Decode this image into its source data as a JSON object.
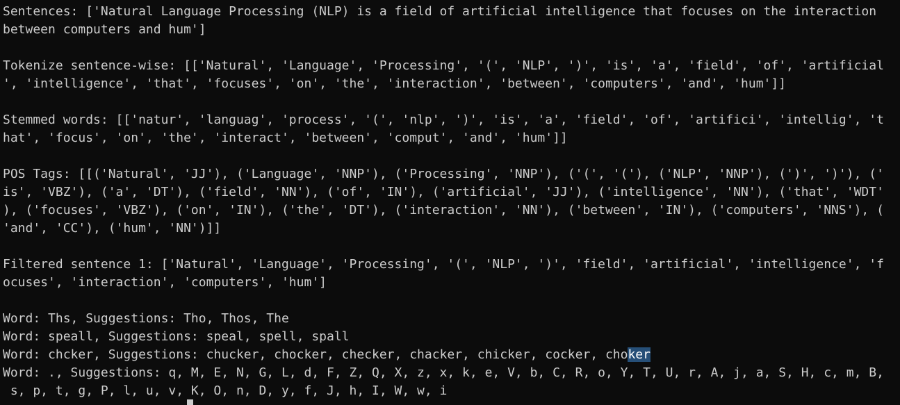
{
  "terminal": {
    "clipped_top": "-------------------------------",
    "lines": [
      "Sentences: ['Natural Language Processing (NLP) is a field of artificial intelligence that focuses on the interaction",
      "between computers and hum']",
      "",
      "Tokenize sentence-wise: [['Natural', 'Language', 'Processing', '(', 'NLP', ')', 'is', 'a', 'field', 'of', 'artificial",
      "', 'intelligence', 'that', 'focuses', 'on', 'the', 'interaction', 'between', 'computers', 'and', 'hum']]",
      "",
      "Stemmed words: [['natur', 'languag', 'process', '(', 'nlp', ')', 'is', 'a', 'field', 'of', 'artifici', 'intellig', 't",
      "hat', 'focus', 'on', 'the', 'interact', 'between', 'comput', 'and', 'hum']]",
      "",
      "POS Tags: [[('Natural', 'JJ'), ('Language', 'NNP'), ('Processing', 'NNP'), ('(', '('), ('NLP', 'NNP'), (')', ')'), ('",
      "is', 'VBZ'), ('a', 'DT'), ('field', 'NN'), ('of', 'IN'), ('artificial', 'JJ'), ('intelligence', 'NN'), ('that', 'WDT'",
      "), ('focuses', 'VBZ'), ('on', 'IN'), ('the', 'DT'), ('interaction', 'NN'), ('between', 'IN'), ('computers', 'NNS'), (",
      "'and', 'CC'), ('hum', 'NN')]]",
      "",
      "Filtered sentence 1: ['Natural', 'Language', 'Processing', '(', 'NLP', ')', 'field', 'artificial', 'intelligence', 'f",
      "ocuses', 'interaction', 'computers', 'hum']",
      "",
      "Word: Ths, Suggestions: Tho, Thos, The",
      "Word: speall, Suggestions: speal, spell, spall",
      "Word: chcker, Suggestions: chucker, chocker, checker, chacker, chicker, cocker, cho",
      "Word: ., Suggestions: q, M, E, N, G, L, d, F, Z, Q, X, z, x, k, e, V, b, C, R, o, Y, T, U, r, A, j, a, S, H, c, m, B,",
      " s, p, t, g, P, l, u, v, K, O, n, D, y, f, J, h, I, W, w, i"
    ],
    "selected_text": "ker",
    "colors": {
      "background": "#0c0c0c",
      "foreground": "#cccccc",
      "selection": "#264f78"
    }
  }
}
